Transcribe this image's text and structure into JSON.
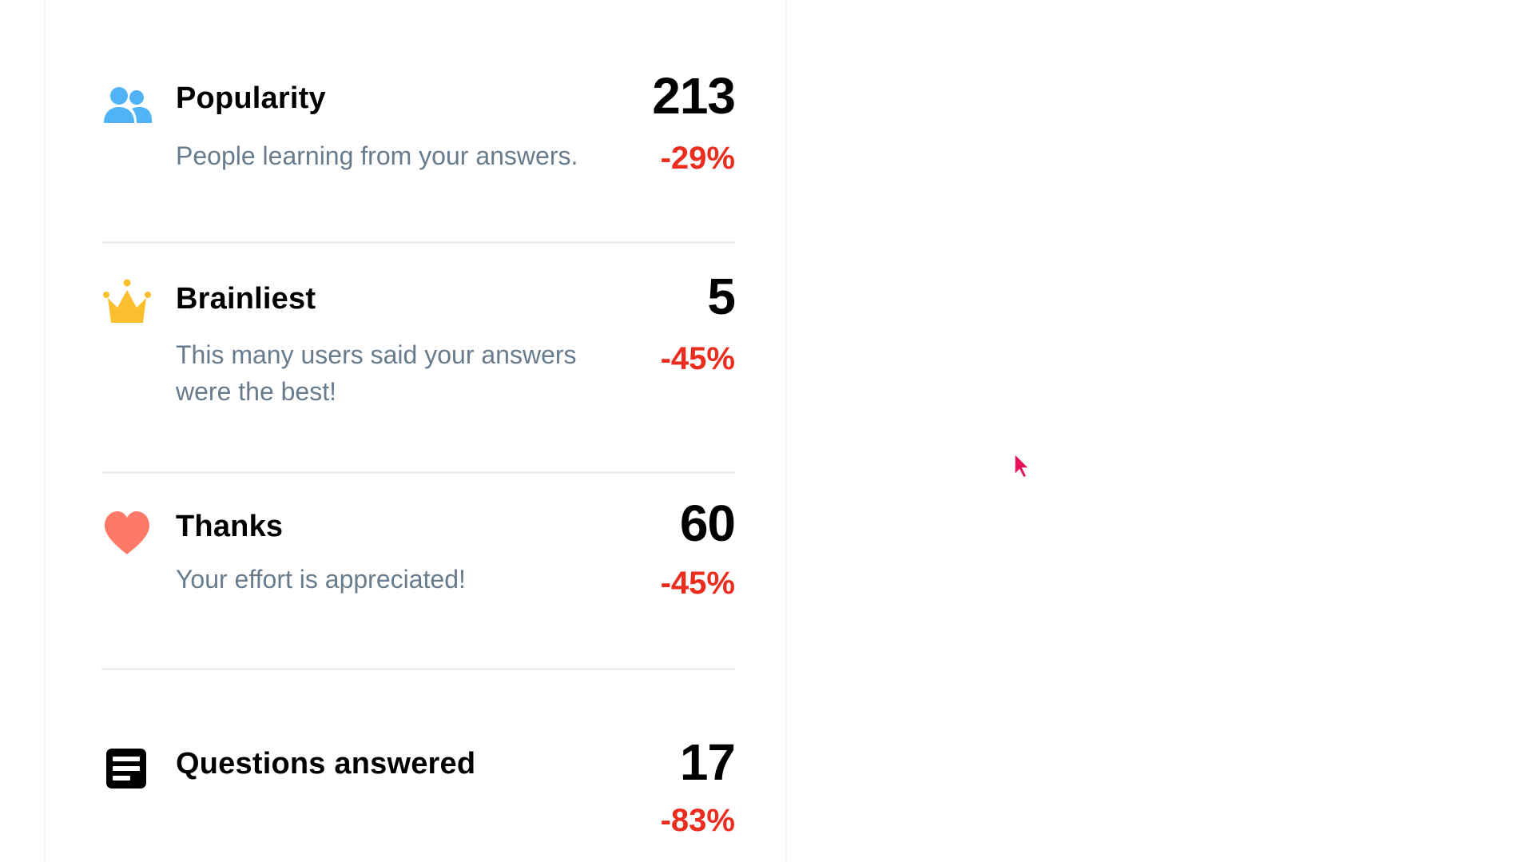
{
  "colors": {
    "change_negative": "#ea2d1f",
    "popularity_icon": "#4fb3f6",
    "brainliest_icon": "#fbbe2e",
    "thanks_icon": "#ff7968",
    "questions_icon": "#000000",
    "cursor": "#e8125c"
  },
  "stats": [
    {
      "icon": "people-icon",
      "title": "Popularity",
      "description": "People learning from your answers.",
      "value": "213",
      "change": "-29%"
    },
    {
      "icon": "crown-icon",
      "title": "Brainliest",
      "description": "This many users said your answers were the best!",
      "value": "5",
      "change": "-45%"
    },
    {
      "icon": "heart-icon",
      "title": "Thanks",
      "description": "Your effort is appreciated!",
      "value": "60",
      "change": "-45%"
    },
    {
      "icon": "answers-icon",
      "title": "Questions answered",
      "description": "",
      "value": "17",
      "change": "-83%"
    }
  ]
}
